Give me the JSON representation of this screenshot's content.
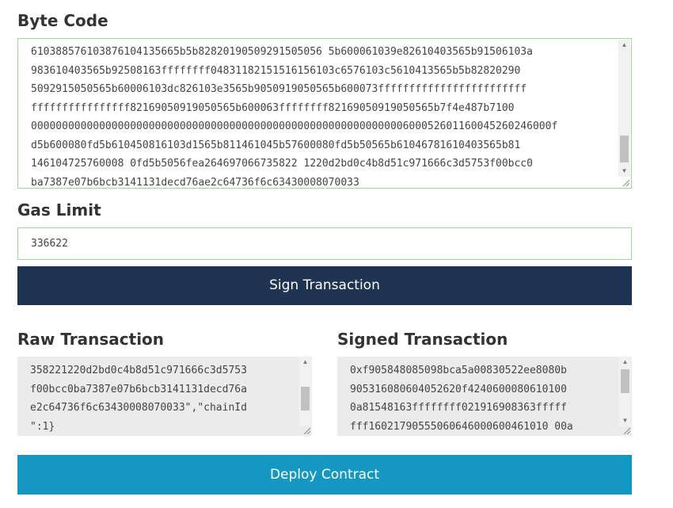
{
  "bytecode": {
    "label": "Byte Code",
    "lines": [
      "610388576103876104135665b5b82820190509291505056 5b600061039e82610403565b91506103a",
      "983610403565b92508163ffffffff04831182151516156103c6576103c5610413565b5b82820290",
      "5092915050565b60006103dc826103e3565b9050919050565b600073ffffffffffffffffffffffff",
      "ffffffffffffffff82169050919050565b600063ffffffff82169050919050565b7f4e487b7100",
      "000000000000000000000000000000000000000000000000000000000000600052601160045260246000f",
      "d5b600080fd5b610450816103d1565b811461045b57600080fd5b50565b61046781610403565b81",
      "146104725760008 0fd5b5056fea264697066735822 1220d2bd0c4b8d51c971666c3d5753f00bcc0",
      "ba7387e07b6bcb3141131decd76ae2c64736f6c63430008070033"
    ]
  },
  "gas": {
    "label": "Gas Limit",
    "value": "336622"
  },
  "sign_button": "Sign Transaction",
  "raw": {
    "label": "Raw Transaction",
    "lines": [
      "358221220d2bd0c4b8d51c971666c3d5753",
      "f00bcc0ba7387e07b6bcb3141131decd76a",
      "e2c64736f6c63430008070033\",\"chainId",
      "\":1}"
    ]
  },
  "signed": {
    "label": "Signed Transaction",
    "lines": [
      "0xf905848085098bca5a00830522ee8080b",
      "905316080604052620f4240600080610100",
      "0a81548163ffffffff021916908363fffff",
      "fff16021790555060646000600461010 00a"
    ]
  },
  "deploy_button": "Deploy Contract"
}
